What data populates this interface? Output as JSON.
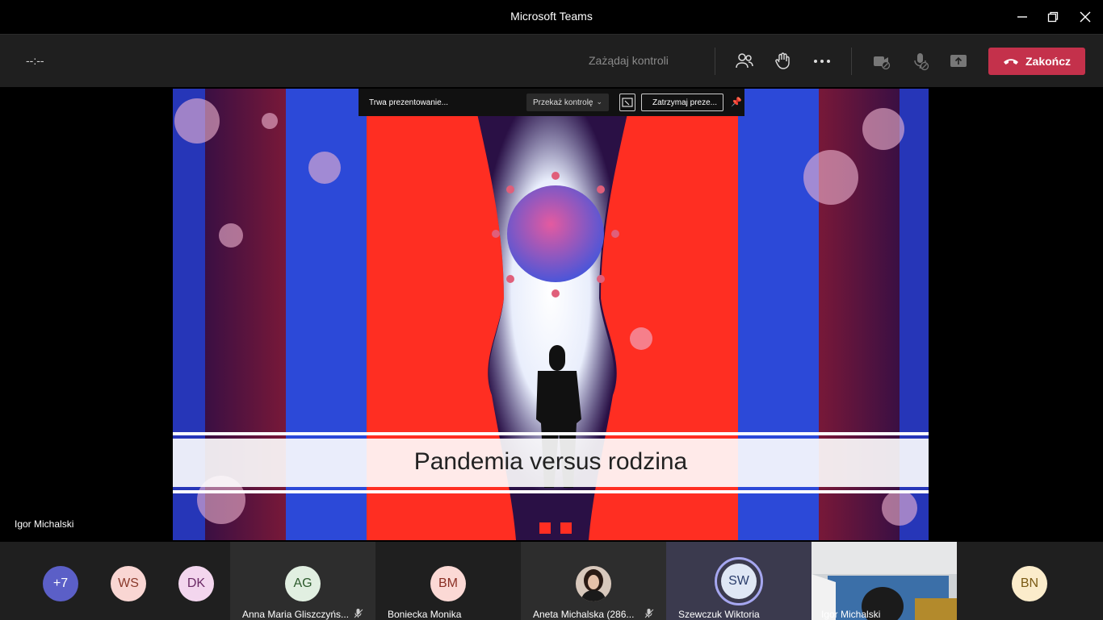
{
  "window": {
    "title": "Microsoft Teams"
  },
  "toolbar": {
    "timer": "--:--",
    "request_control": "Zażądaj kontroli",
    "end_label": "Zakończ"
  },
  "share": {
    "status": "Trwa prezentowanie...",
    "give_control": "Przekaż kontrolę",
    "stop": "Zatrzymaj preze..."
  },
  "stage": {
    "presenter": "Igor Michalski",
    "slide_title": "Pandemia versus rodzina"
  },
  "participants": {
    "overflow": "+7",
    "avatars": [
      {
        "initials": "WS",
        "bg": "#f9d6d3",
        "fg": "#8a3a2b"
      },
      {
        "initials": "DK",
        "bg": "#f3d6ee",
        "fg": "#6b2a66"
      }
    ],
    "tiles": [
      {
        "initials": "AG",
        "name": "Anna Maria Gliszczyńs...",
        "bg": "#e1efe1",
        "fg": "#2c5a2c"
      },
      {
        "initials": "BM",
        "name": "Boniecka Monika",
        "bg": "#fbd9d5",
        "fg": "#8a2f24"
      },
      {
        "initials": "",
        "name": "Aneta Michalska (286..."
      },
      {
        "initials": "SW",
        "name": "Szewczuk Wiktoria",
        "bg": "#dfe7f5",
        "fg": "#2a3d6b"
      },
      {
        "initials": "",
        "name": "Igor Michalski"
      },
      {
        "initials": "BN",
        "name": "",
        "bg": "#fbeccb",
        "fg": "#7a5a14"
      }
    ]
  },
  "colors": {
    "end": "#c4314b",
    "overflow_bg": "#5b5fc7"
  }
}
